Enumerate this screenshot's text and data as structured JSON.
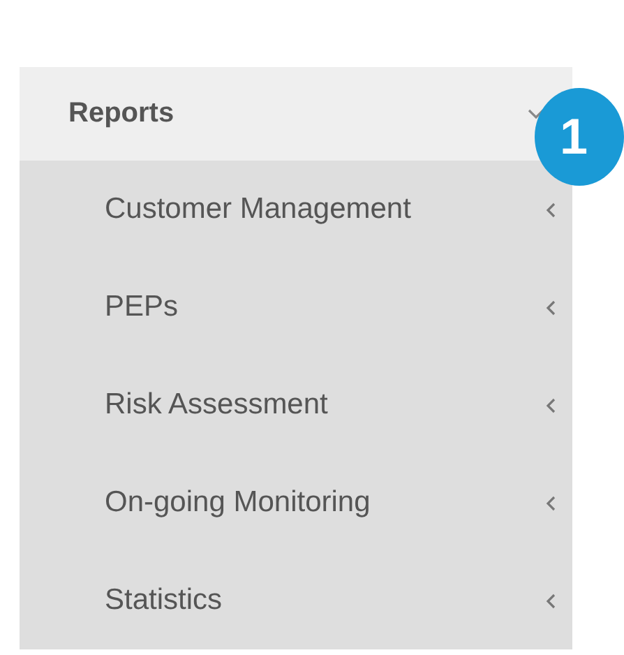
{
  "menu": {
    "title": "Reports",
    "expanded": true,
    "items": [
      {
        "label": "Customer Management",
        "expanded": false
      },
      {
        "label": "PEPs",
        "expanded": false
      },
      {
        "label": "Risk Assessment",
        "expanded": false
      },
      {
        "label": "On-going Monitoring",
        "expanded": false
      },
      {
        "label": "Statistics",
        "expanded": false
      }
    ]
  },
  "badge": "1"
}
